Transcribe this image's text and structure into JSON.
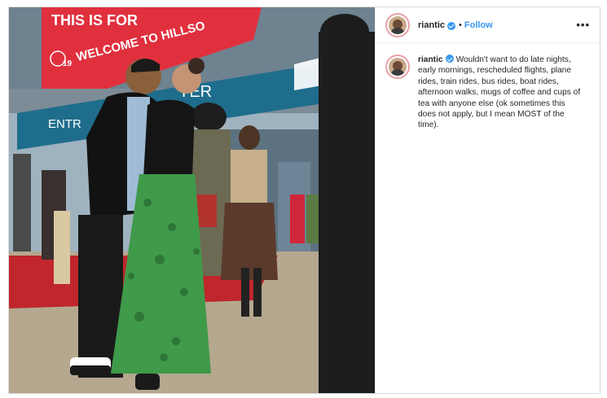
{
  "post": {
    "username": "riantic",
    "follow_label": "Follow",
    "dot": "•",
    "more_label": "•••",
    "caption": "Wouldn't want to do late nights, early mornings, rescheduled flights, plane rides, train rides, bus rides, boat rides, afternoon walks, mugs of coffee and cups of tea with anyone else (ok sometimes this does not apply, but I mean MOST of the time)."
  },
  "photo": {
    "banner_top": "THIS IS FOR",
    "banner_text": "WELCOME TO HILLSO",
    "banner_badge": "19",
    "sign_left": "ENTR",
    "sign_mid": "YER"
  },
  "colors": {
    "accent_blue": "#3897f0",
    "banner_red": "#e0303e",
    "sign_teal": "#1f6d8c",
    "skirt_green": "#3f9a4a",
    "carpet_red": "#c0262c"
  }
}
